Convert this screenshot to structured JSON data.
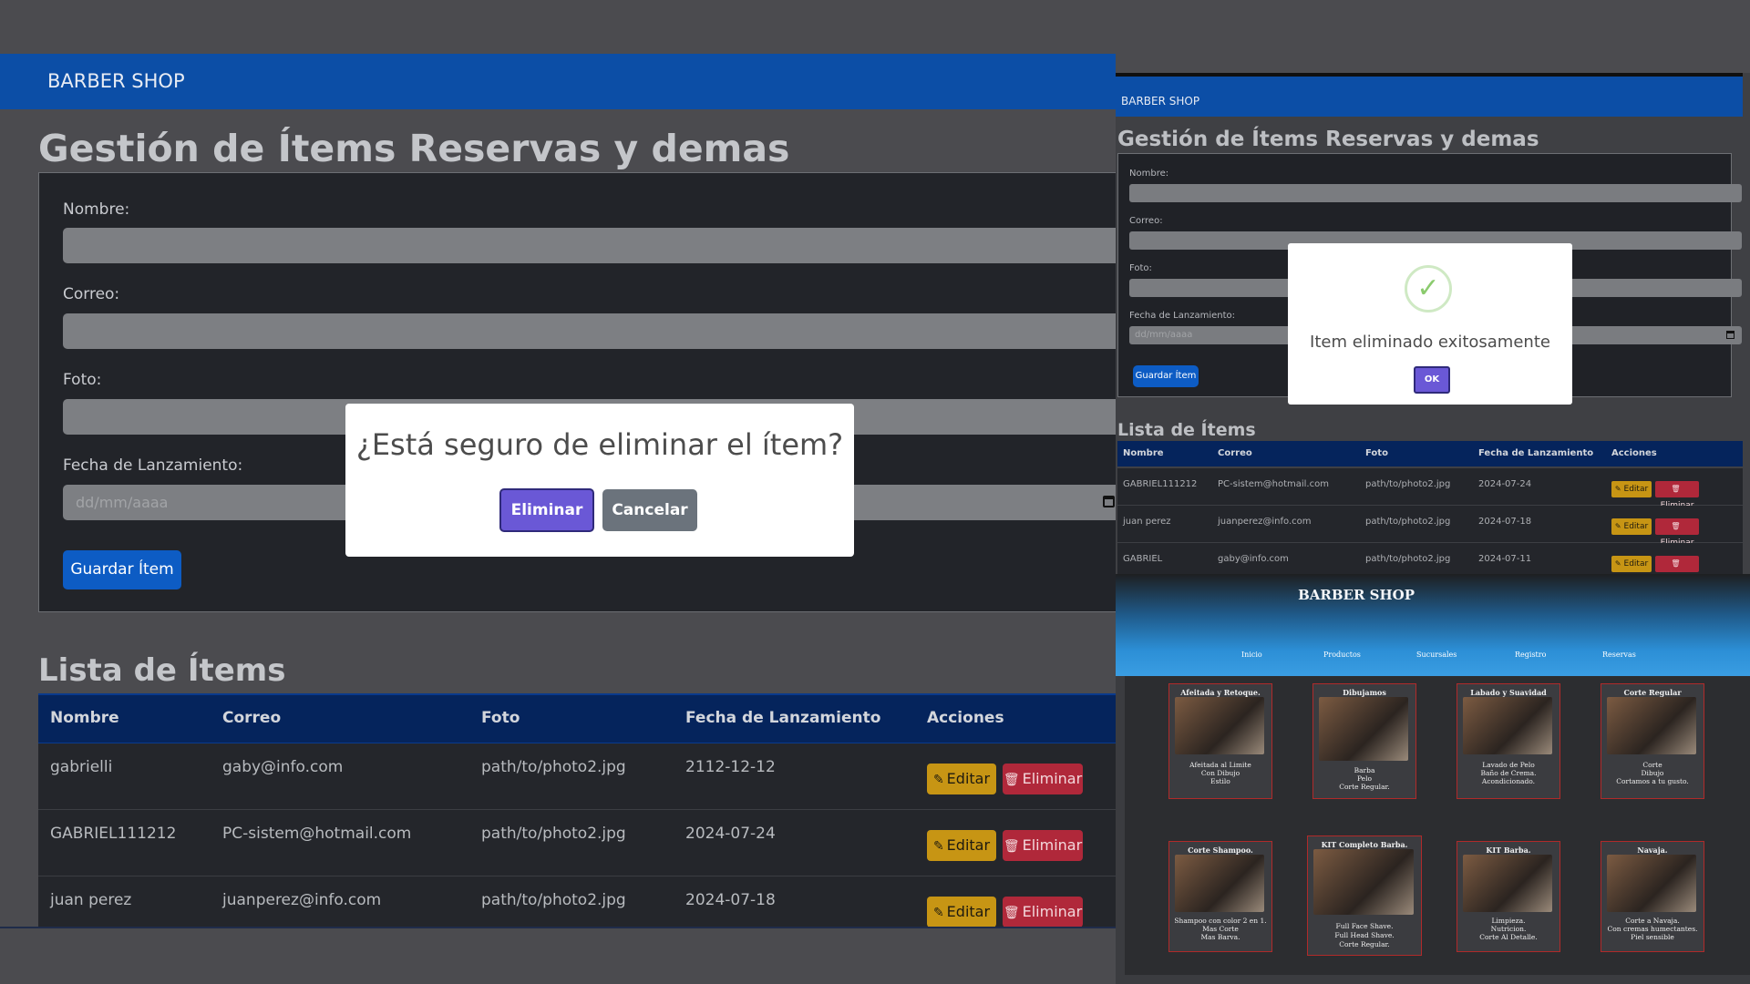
{
  "left": {
    "brand": "BARBER SHOP",
    "title": "Gestión de Ítems Reservas y demas",
    "form": {
      "name_label": "Nombre:",
      "email_label": "Correo:",
      "photo_label": "Foto:",
      "date_label": "Fecha de Lanzamiento:",
      "date_placeholder": "dd/mm/aaaa",
      "save_label": "Guardar Ítem"
    },
    "list_title": "Lista de Ítems",
    "columns": [
      "Nombre",
      "Correo",
      "Foto",
      "Fecha de Lanzamiento",
      "Acciones"
    ],
    "rows": [
      {
        "name": "gabrielli",
        "email": "gaby@info.com",
        "photo": "path/to/photo2.jpg",
        "date": "2112-12-12"
      },
      {
        "name": "GABRIEL111212",
        "email": "PC-sistem@hotmail.com",
        "photo": "path/to/photo2.jpg",
        "date": "2024-07-24"
      },
      {
        "name": "juan perez",
        "email": "juanperez@info.com",
        "photo": "path/to/photo2.jpg",
        "date": "2024-07-18"
      }
    ],
    "edit_label": "Editar",
    "delete_label": "Eliminar",
    "confirm": {
      "question": "¿Está seguro de eliminar el ítem?",
      "confirm_label": "Eliminar",
      "cancel_label": "Cancelar"
    }
  },
  "right_top": {
    "brand": "BARBER SHOP",
    "title": "Gestión de Ítems Reservas y demas",
    "form": {
      "name_label": "Nombre:",
      "email_label": "Correo:",
      "photo_label": "Foto:",
      "date_label": "Fecha de Lanzamiento:",
      "date_placeholder": "dd/mm/aaaa",
      "save_label": "Guardar Ítem"
    },
    "list_title": "Lista de Ítems",
    "columns": [
      "Nombre",
      "Correo",
      "Foto",
      "Fecha de Lanzamiento",
      "Acciones"
    ],
    "rows": [
      {
        "name": "GABRIEL111212",
        "email": "PC-sistem@hotmail.com",
        "photo": "path/to/photo2.jpg",
        "date": "2024-07-24"
      },
      {
        "name": "juan perez",
        "email": "juanperez@info.com",
        "photo": "path/to/photo2.jpg",
        "date": "2024-07-18"
      },
      {
        "name": "GABRIEL",
        "email": "gaby@info.com",
        "photo": "path/to/photo2.jpg",
        "date": "2024-07-11"
      }
    ],
    "edit_label": "Editar",
    "delete_label": "Eliminar",
    "alert": {
      "message": "Item eliminado exitosamente",
      "ok_label": "OK"
    }
  },
  "right_bottom": {
    "brand": "BARBER SHOP",
    "nav": [
      "Inicio",
      "Productos",
      "Sucursales",
      "Registro",
      "Reservas"
    ],
    "cards": [
      {
        "title": "Afeitada y Retoque.",
        "lines": [
          "Afeitada al Limite",
          "Con Dibujo",
          "Estilo"
        ]
      },
      {
        "title": "Dibujamos",
        "lines": [
          "Barba",
          "Pelo",
          "Corte Regular."
        ]
      },
      {
        "title": "Labado y Suavidad",
        "lines": [
          "Lavado de Pelo",
          "Baño de Crema.",
          "Acondicionado."
        ]
      },
      {
        "title": "Corte Regular",
        "lines": [
          "Corte",
          "Dibujo",
          "Cortamos a tu gusto."
        ]
      },
      {
        "title": "Corte Shampoo.",
        "lines": [
          "Shampoo con color 2 en 1.",
          "Mas Corte",
          "Mas Barva."
        ]
      },
      {
        "title": "KIT Completo Barba.",
        "lines": [
          "Full Face Shave.",
          "Full Head Shave.",
          "Corte Regular."
        ]
      },
      {
        "title": "KIT Barba.",
        "lines": [
          "Limpieza.",
          "Nutricion.",
          "Corte Al Detalle."
        ]
      },
      {
        "title": "Navaja.",
        "lines": [
          "Corte a Navaja.",
          "Con cremas humectantes.",
          "Piel sensible"
        ]
      }
    ]
  },
  "colors": {
    "navbar": "#0c4ea6",
    "table_header": "#05245c",
    "edit": "#c79514",
    "delete": "#b0283a",
    "confirm": "#6a58d6",
    "cancel": "#6b737c"
  }
}
